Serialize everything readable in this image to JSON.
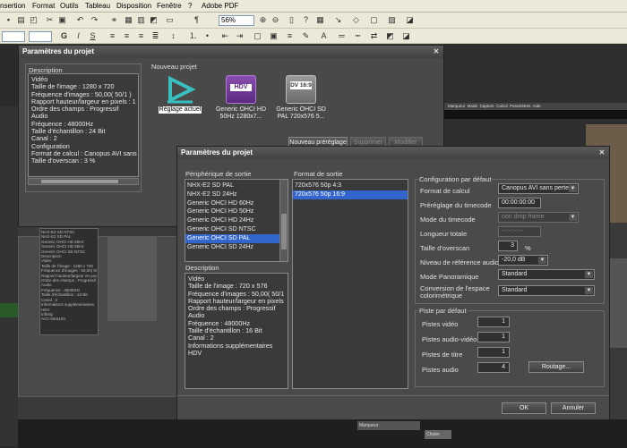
{
  "menubar": {
    "items": [
      "nsertion",
      "Format",
      "Outils",
      "Tableau",
      "Disposition",
      "Fenêtre",
      "?",
      "Adobe PDF"
    ]
  },
  "toolbar": {
    "zoom": "56%"
  },
  "dialog1": {
    "title": "Paramètres du projet",
    "description_label": "Description",
    "description_lines": [
      "Vidéo",
      "Taille de l'image : 1280 x 720",
      "Fréquence d'images : 50,00( 50/1 )",
      "Rapport hauteur/largeur en pixels : 1",
      "Ordre des champs : Progressif",
      "Audio",
      "Fréquence : 48000Hz",
      "Taille d'échantillon : 24 Bit",
      "Canal : 2",
      "Configuration",
      "Format de calcul : Canopus AVI sans",
      "Taille d'overscan : 3 %"
    ],
    "new_project_label": "Nouveau projet",
    "presets": [
      {
        "label": "Réglage actuel",
        "icon": "current-setting-icon"
      },
      {
        "label": "Generic OHCI HD 50Hz 1280x7...",
        "icon": "hdv-icon",
        "badge": "HDV"
      },
      {
        "label": "Generic OHCI SD PAL 720x576 5...",
        "icon": "dv-169-icon",
        "badge": "DV 16:9"
      }
    ],
    "buttons": {
      "new_preset": "Nouveau préréglage",
      "delete": "Supprimer",
      "modify": "Modifier"
    }
  },
  "dialog2": {
    "title": "Paramètres du projet",
    "output_device_label": "Périphérique de sortie",
    "output_devices": [
      "NHX-E2 SD PAL",
      "NHX-E2 SD 24Hz",
      "Generic OHCI HD 60Hz",
      "Generic OHCI HD 50Hz",
      "Generic OHCI HD 24Hz",
      "Generic OHCI SD NTSC",
      "Generic OHCI SD PAL",
      "Generic OHCI SD 24Hz"
    ],
    "output_device_selected": 6,
    "output_format_label": "Format de sortie",
    "output_formats": [
      "720x576 50p 4:3",
      "720x576 50p 16:9"
    ],
    "output_format_selected": 1,
    "description_label": "Description",
    "description_lines": [
      "Vidéo",
      "Taille de l'image : 720 x 576",
      "Fréquence d'images : 50,00( 50/1",
      "Rapport hauteur/largeur en pixels",
      "Ordre des champs : Progressif",
      "Audio",
      "Fréquence : 48000Hz",
      "Taille d'échantillon : 16 Bit",
      "Canal : 2",
      "Informations supplémentaires",
      "HDV"
    ],
    "defaults_label": "Configuration par défaut",
    "defaults": {
      "calc_format_label": "Format de calcul",
      "calc_format_value": "Canopus AVI sans perte",
      "timecode_preset_label": "Préréglage du timecode",
      "timecode_preset_value": "00:00:00:00",
      "timecode_mode_label": "Mode du timecode",
      "timecode_mode_value": "non drop frame",
      "total_length_label": "Longueur totale",
      "total_length_value": "--:--:--:--",
      "overscan_label": "Taille d'overscan",
      "overscan_value": "3",
      "overscan_unit": "%",
      "audio_ref_label": "Niveau de référence audio",
      "audio_ref_value": "-20,0 dB",
      "panorama_label": "Mode Panoramique",
      "panorama_value": "Standard",
      "colorspace_label_1": "Conversion de l'espace",
      "colorspace_label_2": "colorimétrique",
      "colorspace_value": "Standard"
    },
    "tracks_label": "Piste par défaut",
    "tracks": {
      "video_label": "Pistes vidéo",
      "video_value": "1",
      "av_label": "Pistes audio-vidéo",
      "av_value": "1",
      "title_label": "Pistes de titre",
      "title_value": "1",
      "audio_label": "Pistes audio",
      "audio_value": "4",
      "routing_button": "Routage..."
    },
    "buttons": {
      "ok": "OK",
      "cancel": "Annuler"
    }
  },
  "background": {
    "list_lines": [
      "NHX-E2 SD NTSC",
      "NHX-E2 SD PAL",
      "Generic OHCI HD 60Hz",
      "Generic OHCI HD 50Hz",
      "Generic OHCI SD NTSC",
      "Description",
      "Vidéo",
      "Taille de l'image : 1280 x 720",
      "Fréquence d'images : 50,00( 50/1 )",
      "Rapport hauteur/largeur en pixels",
      "Ordre des champs : Progressif",
      "Audio",
      "Fréquence : 48000Hz",
      "Taille d'échantillon : 24 Bit",
      "Canal : 2",
      "Informations supplémentaires",
      "HDV",
      "Infinity",
      "AVC-Intra100"
    ],
    "topmenu": [
      "Marqueur",
      "Mode",
      "Capture",
      "Calcul",
      "Paramètres",
      "Aide"
    ],
    "marker_label": "Marqueur",
    "chuter_label": "Chuter"
  },
  "colors": {
    "selection": "#3366cc",
    "dialog_bg": "#4a4a4a",
    "chrome": "#ece9d8"
  }
}
